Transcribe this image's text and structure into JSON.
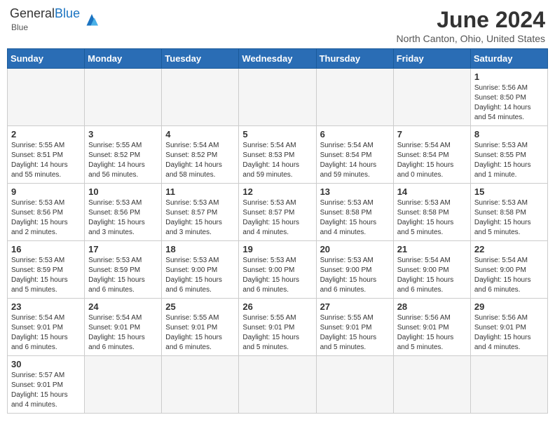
{
  "header": {
    "logo_text_general": "General",
    "logo_text_blue": "Blue",
    "month_year": "June 2024",
    "location": "North Canton, Ohio, United States"
  },
  "days_of_week": [
    "Sunday",
    "Monday",
    "Tuesday",
    "Wednesday",
    "Thursday",
    "Friday",
    "Saturday"
  ],
  "weeks": [
    [
      {
        "day": "",
        "info": ""
      },
      {
        "day": "",
        "info": ""
      },
      {
        "day": "",
        "info": ""
      },
      {
        "day": "",
        "info": ""
      },
      {
        "day": "",
        "info": ""
      },
      {
        "day": "",
        "info": ""
      },
      {
        "day": "1",
        "info": "Sunrise: 5:56 AM\nSunset: 8:50 PM\nDaylight: 14 hours\nand 54 minutes."
      }
    ],
    [
      {
        "day": "2",
        "info": "Sunrise: 5:55 AM\nSunset: 8:51 PM\nDaylight: 14 hours\nand 55 minutes."
      },
      {
        "day": "3",
        "info": "Sunrise: 5:55 AM\nSunset: 8:52 PM\nDaylight: 14 hours\nand 56 minutes."
      },
      {
        "day": "4",
        "info": "Sunrise: 5:54 AM\nSunset: 8:52 PM\nDaylight: 14 hours\nand 58 minutes."
      },
      {
        "day": "5",
        "info": "Sunrise: 5:54 AM\nSunset: 8:53 PM\nDaylight: 14 hours\nand 59 minutes."
      },
      {
        "day": "6",
        "info": "Sunrise: 5:54 AM\nSunset: 8:54 PM\nDaylight: 14 hours\nand 59 minutes."
      },
      {
        "day": "7",
        "info": "Sunrise: 5:54 AM\nSunset: 8:54 PM\nDaylight: 15 hours\nand 0 minutes."
      },
      {
        "day": "8",
        "info": "Sunrise: 5:53 AM\nSunset: 8:55 PM\nDaylight: 15 hours\nand 1 minute."
      }
    ],
    [
      {
        "day": "9",
        "info": "Sunrise: 5:53 AM\nSunset: 8:56 PM\nDaylight: 15 hours\nand 2 minutes."
      },
      {
        "day": "10",
        "info": "Sunrise: 5:53 AM\nSunset: 8:56 PM\nDaylight: 15 hours\nand 3 minutes."
      },
      {
        "day": "11",
        "info": "Sunrise: 5:53 AM\nSunset: 8:57 PM\nDaylight: 15 hours\nand 3 minutes."
      },
      {
        "day": "12",
        "info": "Sunrise: 5:53 AM\nSunset: 8:57 PM\nDaylight: 15 hours\nand 4 minutes."
      },
      {
        "day": "13",
        "info": "Sunrise: 5:53 AM\nSunset: 8:58 PM\nDaylight: 15 hours\nand 4 minutes."
      },
      {
        "day": "14",
        "info": "Sunrise: 5:53 AM\nSunset: 8:58 PM\nDaylight: 15 hours\nand 5 minutes."
      },
      {
        "day": "15",
        "info": "Sunrise: 5:53 AM\nSunset: 8:58 PM\nDaylight: 15 hours\nand 5 minutes."
      }
    ],
    [
      {
        "day": "16",
        "info": "Sunrise: 5:53 AM\nSunset: 8:59 PM\nDaylight: 15 hours\nand 5 minutes."
      },
      {
        "day": "17",
        "info": "Sunrise: 5:53 AM\nSunset: 8:59 PM\nDaylight: 15 hours\nand 6 minutes."
      },
      {
        "day": "18",
        "info": "Sunrise: 5:53 AM\nSunset: 9:00 PM\nDaylight: 15 hours\nand 6 minutes."
      },
      {
        "day": "19",
        "info": "Sunrise: 5:53 AM\nSunset: 9:00 PM\nDaylight: 15 hours\nand 6 minutes."
      },
      {
        "day": "20",
        "info": "Sunrise: 5:53 AM\nSunset: 9:00 PM\nDaylight: 15 hours\nand 6 minutes."
      },
      {
        "day": "21",
        "info": "Sunrise: 5:54 AM\nSunset: 9:00 PM\nDaylight: 15 hours\nand 6 minutes."
      },
      {
        "day": "22",
        "info": "Sunrise: 5:54 AM\nSunset: 9:00 PM\nDaylight: 15 hours\nand 6 minutes."
      }
    ],
    [
      {
        "day": "23",
        "info": "Sunrise: 5:54 AM\nSunset: 9:01 PM\nDaylight: 15 hours\nand 6 minutes."
      },
      {
        "day": "24",
        "info": "Sunrise: 5:54 AM\nSunset: 9:01 PM\nDaylight: 15 hours\nand 6 minutes."
      },
      {
        "day": "25",
        "info": "Sunrise: 5:55 AM\nSunset: 9:01 PM\nDaylight: 15 hours\nand 6 minutes."
      },
      {
        "day": "26",
        "info": "Sunrise: 5:55 AM\nSunset: 9:01 PM\nDaylight: 15 hours\nand 5 minutes."
      },
      {
        "day": "27",
        "info": "Sunrise: 5:55 AM\nSunset: 9:01 PM\nDaylight: 15 hours\nand 5 minutes."
      },
      {
        "day": "28",
        "info": "Sunrise: 5:56 AM\nSunset: 9:01 PM\nDaylight: 15 hours\nand 5 minutes."
      },
      {
        "day": "29",
        "info": "Sunrise: 5:56 AM\nSunset: 9:01 PM\nDaylight: 15 hours\nand 4 minutes."
      }
    ],
    [
      {
        "day": "30",
        "info": "Sunrise: 5:57 AM\nSunset: 9:01 PM\nDaylight: 15 hours\nand 4 minutes."
      },
      {
        "day": "",
        "info": ""
      },
      {
        "day": "",
        "info": ""
      },
      {
        "day": "",
        "info": ""
      },
      {
        "day": "",
        "info": ""
      },
      {
        "day": "",
        "info": ""
      },
      {
        "day": "",
        "info": ""
      }
    ]
  ]
}
